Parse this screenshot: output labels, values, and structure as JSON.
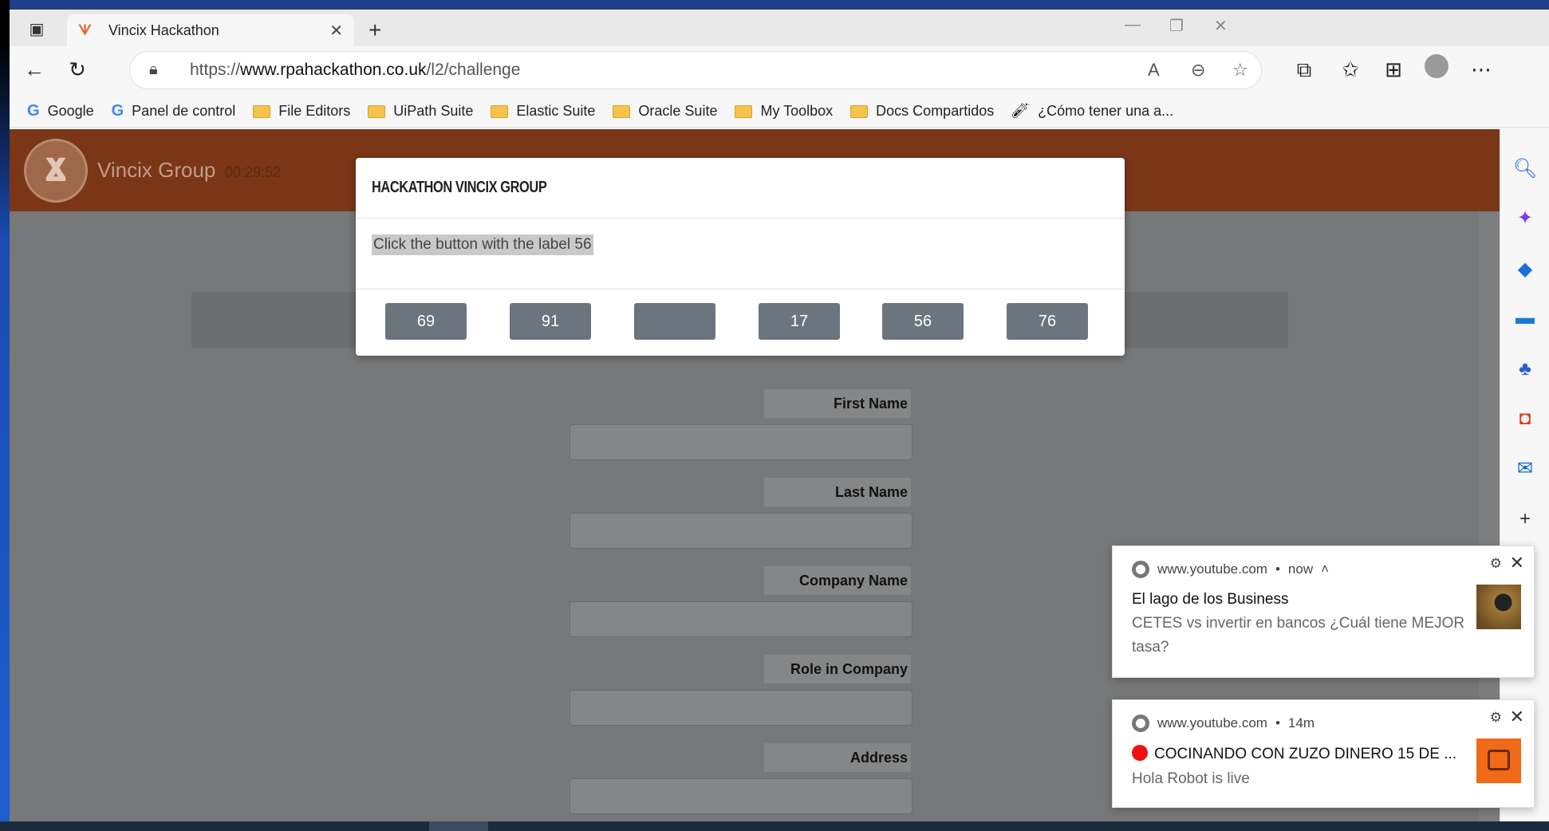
{
  "browser": {
    "tab_title": "Vincix Hackathon",
    "url_prefix": "https://",
    "url_domain": "www.rpahackathon.co.uk",
    "url_path": "/l2/challenge"
  },
  "bookmarks": [
    {
      "label": "Google",
      "icon": "google-icon"
    },
    {
      "label": "Panel de control",
      "icon": "google-icon"
    },
    {
      "label": "File Editors",
      "icon": "folder-icon"
    },
    {
      "label": "UiPath Suite",
      "icon": "folder-icon"
    },
    {
      "label": "Elastic Suite",
      "icon": "folder-icon"
    },
    {
      "label": "Oracle Suite",
      "icon": "folder-icon"
    },
    {
      "label": "My Toolbox",
      "icon": "folder-icon"
    },
    {
      "label": "Docs Compartidos",
      "icon": "folder-icon"
    },
    {
      "label": "¿Cómo tener una a...",
      "icon": "extension-icon"
    }
  ],
  "page": {
    "brand": "Vincix Group",
    "timer": "00:29:52",
    "form_labels": [
      "First Name",
      "Last Name",
      "Company Name",
      "Role in Company",
      "Address"
    ]
  },
  "modal": {
    "title": "HACKATHON VINCIX GROUP",
    "instruction": "Click the button with the label 56",
    "buttons": [
      "69",
      "91",
      "",
      "17",
      "56",
      "76"
    ]
  },
  "notifications": [
    {
      "source": "www.youtube.com",
      "time": "now",
      "title": "El lago de los Business",
      "body": "CETES vs invertir en bancos ¿Cuál tiene MEJOR tasa?"
    },
    {
      "source": "www.youtube.com",
      "time": "14m",
      "title": "COCINANDO CON ZUZO DINERO 15 DE ...",
      "body": "Hola Robot is live"
    }
  ],
  "colors": {
    "header_brown": "#7a3617",
    "button_grey": "#6c757d",
    "overlay_grey": "#777879"
  }
}
